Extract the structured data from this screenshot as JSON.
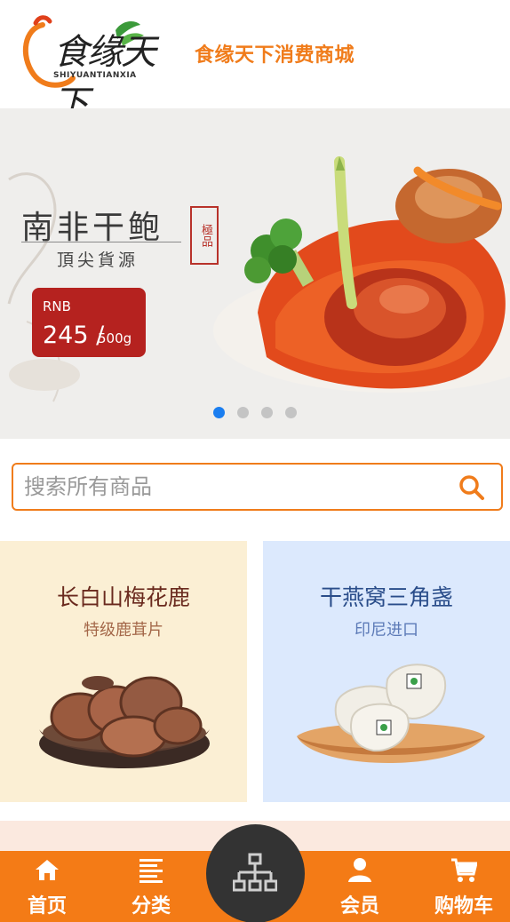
{
  "header": {
    "logo_text": "食缘天下",
    "logo_sub": "SHIYUANTIANXIA",
    "title": "食缘天下消费商城"
  },
  "banner": {
    "title": "南非干鲍",
    "subtitle": "頂尖貨源",
    "seal_text": "極品",
    "price_currency": "RNB",
    "price_value": "245 /",
    "price_unit": "500g",
    "slides": 4,
    "active_slide": 1
  },
  "search": {
    "placeholder": "搜索所有商品",
    "value": ""
  },
  "products": [
    {
      "title": "长白山梅花鹿",
      "subtitle": "特级鹿茸片"
    },
    {
      "title": "干燕窝三角盏",
      "subtitle": "印尼进口"
    }
  ],
  "bottom_nav": {
    "items": [
      {
        "label": "首页",
        "icon": "home-icon"
      },
      {
        "label": "分类",
        "icon": "category-list-icon"
      },
      {
        "label": "会员",
        "icon": "member-icon"
      },
      {
        "label": "购物车",
        "icon": "cart-icon"
      }
    ],
    "center_icon": "sitemap-icon"
  },
  "colors": {
    "accent": "#f47b16",
    "header_title": "#f07c1b",
    "active_dot": "#1b7ef0",
    "price_box": "#b5221f"
  }
}
